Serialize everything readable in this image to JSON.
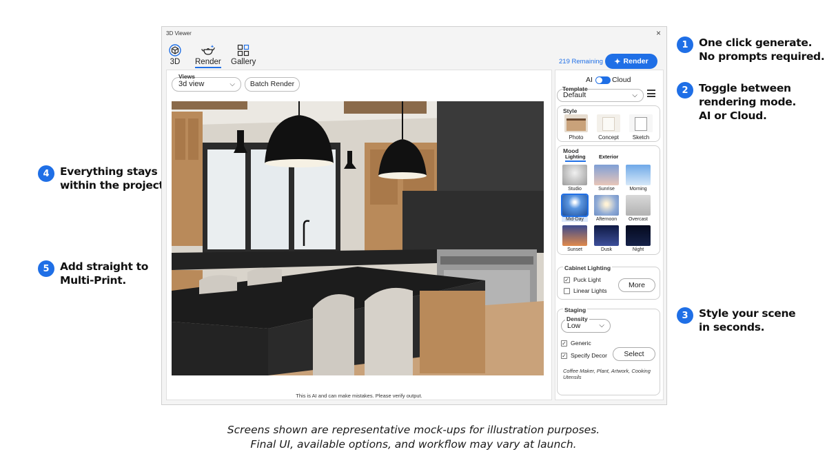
{
  "window": {
    "title": "3D Viewer",
    "close": "×"
  },
  "tabs": [
    {
      "label": "3D",
      "icon": "cube-icon"
    },
    {
      "label": "Render",
      "icon": "teapot-sparkle-icon",
      "active": true
    },
    {
      "label": "Gallery",
      "icon": "grid-icon"
    }
  ],
  "render": {
    "remaining": "219 Remaining",
    "button_label": "Render",
    "icon": "sparkle-icon"
  },
  "views": {
    "label": "Views",
    "value": "3d view",
    "batch_label": "Batch Render"
  },
  "disclaimer": "This is AI and can make mistakes. Please verify output.",
  "mode": {
    "ai_label": "AI",
    "cloud_label": "Cloud",
    "selected": "Cloud"
  },
  "template": {
    "label": "Template",
    "value": "Default"
  },
  "style": {
    "title": "Style",
    "items": [
      {
        "label": "Photo"
      },
      {
        "label": "Concept"
      },
      {
        "label": "Sketch"
      }
    ]
  },
  "mood": {
    "title": "Mood",
    "tabs": [
      {
        "label": "Lighting",
        "active": true
      },
      {
        "label": "Exterior"
      }
    ],
    "items": [
      {
        "label": "Studio",
        "color": "#b9b9b9"
      },
      {
        "label": "Sunrise",
        "color": "#a9b8d6"
      },
      {
        "label": "Morning",
        "color": "#9cc4ec"
      },
      {
        "label": "Mid-Day",
        "color": "#2f6fc2",
        "selected": true
      },
      {
        "label": "Afternoon",
        "color": "#c9b89a"
      },
      {
        "label": "Overcast",
        "color": "#c7c7c7"
      },
      {
        "label": "Sunset",
        "color": "#c86a3c"
      },
      {
        "label": "Dusk",
        "color": "#1d2a5a"
      },
      {
        "label": "Night",
        "color": "#0c1230"
      }
    ]
  },
  "cabinet_lighting": {
    "title": "Cabinet Lighting",
    "options": [
      {
        "label": "Puck Light",
        "checked": true
      },
      {
        "label": "Linear Lights",
        "checked": false
      }
    ],
    "more_label": "More"
  },
  "staging": {
    "title": "Staging",
    "density_label": "Density",
    "density_value": "Low",
    "options": [
      {
        "label": "Generic",
        "checked": true
      },
      {
        "label": "Specify Decor",
        "checked": true
      }
    ],
    "select_label": "Select",
    "decor_note": "Coffee Maker, Plant, Artwork, Cooking Utensils"
  },
  "callouts": [
    {
      "num": "1",
      "lines": [
        "One click generate.",
        "No prompts required."
      ]
    },
    {
      "num": "2",
      "lines": [
        "Toggle between",
        "rendering mode.",
        "AI or Cloud."
      ]
    },
    {
      "num": "3",
      "lines": [
        "Style your scene",
        "in seconds."
      ]
    },
    {
      "num": "4",
      "lines": [
        "Everything stays",
        "within the project."
      ]
    },
    {
      "num": "5",
      "lines": [
        "Add straight to",
        "Multi-Print."
      ]
    }
  ],
  "caption": {
    "line1": "Screens shown are representative mock-ups for illustration purposes.",
    "line2": "Final UI, available options, and workflow may vary at launch."
  },
  "colors": {
    "accent": "#1f6fe6"
  }
}
